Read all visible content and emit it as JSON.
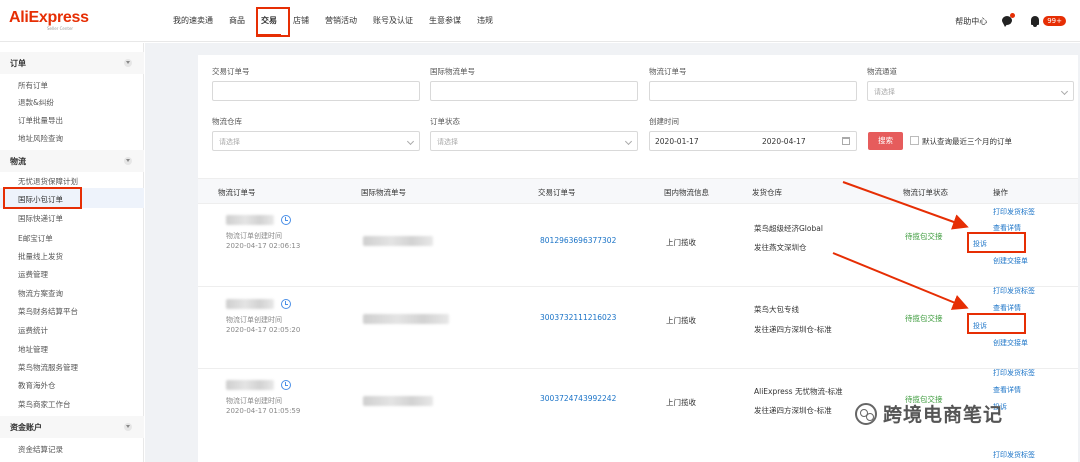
{
  "header": {
    "logo": "AliExpress",
    "logo_sub": "Seller Center",
    "nav": [
      "我的速卖通",
      "商品",
      "交易",
      "店铺",
      "营销活动",
      "账号及认证",
      "生意参谋",
      "违规"
    ],
    "active_nav": "交易",
    "help": "帮助中心",
    "badge": "99+"
  },
  "sidebar": {
    "groups": [
      {
        "title": "订单",
        "items": [
          "所有订单",
          "退款&纠纷",
          "订单批量导出",
          "地址风险查询"
        ]
      },
      {
        "title": "物流",
        "items": [
          "无忧退货保障计划",
          "国际小包订单",
          "国际快递订单",
          "E邮宝订单",
          "批量线上发货",
          "运费管理",
          "物流方案查询",
          "菜鸟财务结算平台",
          "运费统计",
          "地址管理",
          "菜鸟物流服务管理",
          "教育海外仓",
          "菜鸟商家工作台"
        ]
      },
      {
        "title": "资金账户",
        "items": [
          "资金结算记录"
        ]
      }
    ],
    "active_item": "国际小包订单"
  },
  "filters": {
    "trade_order_label": "交易订单号",
    "intl_no_label": "国际物流单号",
    "logistics_no_label": "物流订单号",
    "channel_label": "物流通道",
    "channel_placeholder": "请选择",
    "warehouse_label": "物流仓库",
    "warehouse_placeholder": "请选择",
    "status_label": "订单状态",
    "status_placeholder": "请选择",
    "created_label": "创建时间",
    "date_from": "2020-01-17",
    "date_to": "2020-04-17",
    "search_button": "搜索",
    "checkbox_label": "默认查询最近三个月的订单"
  },
  "table": {
    "headers": [
      "物流订单号",
      "国际物流单号",
      "交易订单号",
      "国内物流信息",
      "发货仓库",
      "物流订单状态",
      "操作"
    ],
    "rows": [
      {
        "created_label": "物流订单创建时间",
        "created": "2020-04-17 02:06:13",
        "trade_no": "8012963696377302",
        "domestic": "上门揽收",
        "warehouse_1": "菜鸟超级经济Global",
        "warehouse_2": "发往燕文深圳仓",
        "status": "待揽包交接",
        "actions": [
          "打印发货标签",
          "查看详情",
          "投诉",
          "创建交接单"
        ]
      },
      {
        "created_label": "物流订单创建时间",
        "created": "2020-04-17 02:05:20",
        "trade_no": "3003732111216023",
        "domestic": "上门揽收",
        "warehouse_1": "菜鸟大包专线",
        "warehouse_2": "发往递四方深圳仓-标准",
        "status": "待揽包交接",
        "actions": [
          "打印发货标签",
          "查看详情",
          "投诉",
          "创建交接单"
        ]
      },
      {
        "created_label": "物流订单创建时间",
        "created": "2020-04-17 01:05:59",
        "trade_no": "3003724743992242",
        "domestic": "上门揽收",
        "warehouse_1": "AliExpress 无忧物流-标准",
        "warehouse_2": "发往递四方深圳仓-标准",
        "status": "待揽包交接",
        "actions": [
          "打印发货标签",
          "查看详情",
          "投诉",
          "打印发货标签"
        ]
      }
    ]
  },
  "watermark": "跨境电商笔记",
  "colors": {
    "brand": "#e62e04",
    "link": "#1a73c7",
    "status": "#3a9a3a",
    "annotation": "#e62e04"
  }
}
